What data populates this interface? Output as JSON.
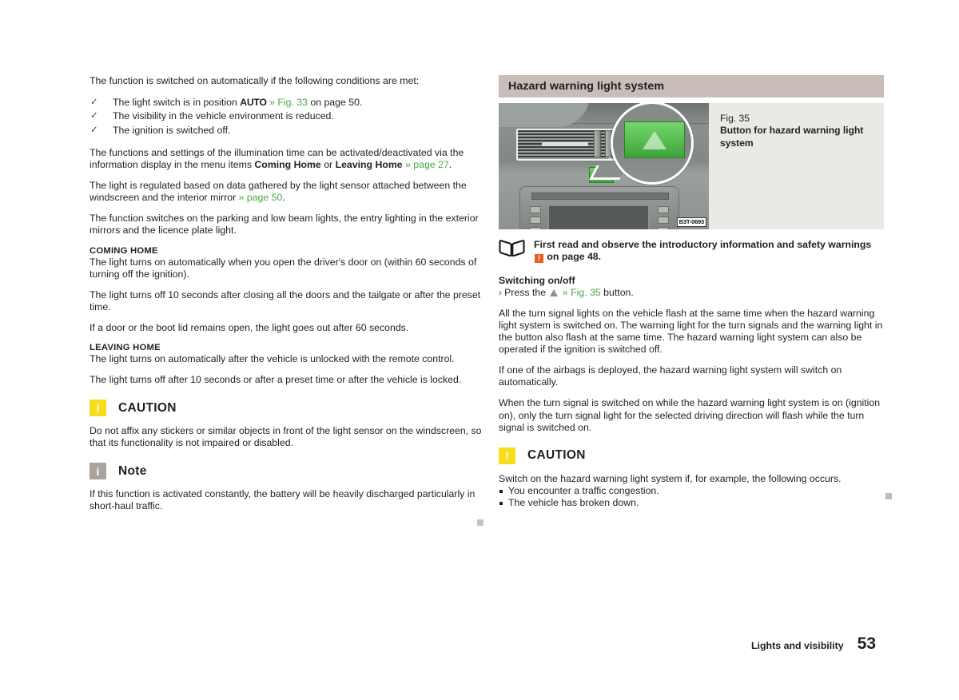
{
  "left_column": {
    "intro_paragraph": "The function is switched on automatically if the following conditions are met:",
    "conditions": [
      {
        "text_before": "The light switch is in position ",
        "bold_token": "AUTO",
        "link": "» Fig. 33",
        "text_after": " on page 50."
      },
      {
        "text_before": "The visibility in the vehicle environment is reduced.",
        "bold_token": "",
        "link": "",
        "text_after": ""
      },
      {
        "text_before": "The ignition is switched off.",
        "bold_token": "",
        "link": "",
        "text_after": ""
      }
    ],
    "settings_para_1": "The functions and settings of the illumination time can be activated/deactivated via the information display in the menu items ",
    "settings_bold_1": "Coming Home",
    "settings_mid": " or ",
    "settings_bold_2": "Leaving Home",
    "settings_link": "» page 27",
    "settings_end": ".",
    "sensor_para": "The light is regulated based on data gathered by the light sensor attached between the windscreen and the interior mirror ",
    "sensor_link": "» page 50",
    "sensor_end": ".",
    "switches_para": "The function switches on the parking and low beam lights, the entry lighting in the exterior mirrors and the licence plate light.",
    "coming_home": {
      "heading": "COMING HOME",
      "paragraphs": [
        "The light turns on automatically when you open the driver's door on (within 60 seconds of turning off the ignition).",
        "The light turns off 10 seconds after closing all the doors and the tailgate or after the preset time.",
        "If a door or the boot lid remains open, the light goes out after 60 seconds."
      ]
    },
    "leaving_home": {
      "heading": "LEAVING HOME",
      "paragraphs": [
        "The light turns on automatically after the vehicle is unlocked with the remote control.",
        "The light turns off after 10 seconds or after a preset time or after the vehicle is locked."
      ]
    },
    "caution": {
      "icon_glyph": "!",
      "title": "CAUTION",
      "body": "Do not affix any stickers or similar objects in front of the light sensor on the windscreen, so that its functionality is not impaired or disabled."
    },
    "note": {
      "icon_glyph": "i",
      "title": "Note",
      "body": "If this function is activated constantly, the battery will be heavily discharged particularly in short-haul traffic."
    }
  },
  "right_column": {
    "section_title": "Hazard warning light system",
    "figure": {
      "number": "Fig. 35",
      "caption": "Button for hazard warning light system",
      "image_code": "B3T-0693",
      "alt": "Car centre console with green hazard warning light button and magnified callout"
    },
    "read_first": {
      "text_1": "First read and observe the introductory information and safety warnings ",
      "warn_glyph": "!",
      "text_2": " on page 48."
    },
    "switching": {
      "heading": "Switching on/off",
      "step_prefix": "Press the ",
      "step_link": "» Fig. 35",
      "step_suffix": " button."
    },
    "paragraphs": [
      "All the turn signal lights on the vehicle flash at the same time when the hazard warning light system is switched on. The warning light for the turn signals and the warning light in the button also flash at the same time. The hazard warning light system can also be operated if the ignition is switched off.",
      "If one of the airbags is deployed, the hazard warning light system will switch on automatically.",
      "When the turn signal is switched on while the hazard warning light system is on (ignition on), only the turn signal light for the selected driving direction will flash while the turn signal is switched on."
    ],
    "caution": {
      "icon_glyph": "!",
      "title": "CAUTION",
      "lead": "Switch on the hazard warning light system if, for example, the following occurs.",
      "items": [
        "You encounter a traffic congestion.",
        "The vehicle has broken down."
      ]
    }
  },
  "footer": {
    "chapter": "Lights and visibility",
    "page_number": "53"
  },
  "colors": {
    "link_green": "#4aa845",
    "caution_yellow": "#f7dd1c",
    "note_gray": "#a9a3a0",
    "warn_orange": "#ef5a21",
    "section_bar": "#c8bdb8",
    "figure_bg": "#e9e9e5",
    "end_marker": "#c9bfc1"
  }
}
